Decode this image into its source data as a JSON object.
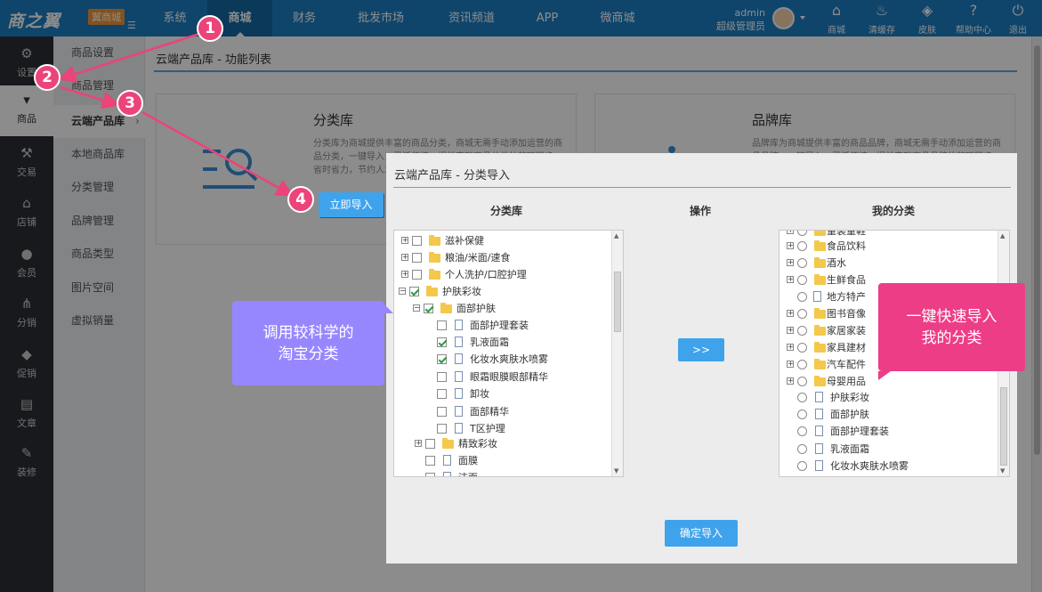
{
  "brand": {
    "logo_text": "商之翼",
    "badge": "翼商城",
    "menu_toggle": "☰"
  },
  "nav": [
    {
      "label": "系统"
    },
    {
      "label": "商城"
    },
    {
      "label": "财务"
    },
    {
      "label": "批发市场"
    },
    {
      "label": "资讯频道"
    },
    {
      "label": "APP"
    },
    {
      "label": "微商城"
    }
  ],
  "user": {
    "name": "admin",
    "role": "超级管理员"
  },
  "top_tools": [
    {
      "label": "商城",
      "icon": "home-icon",
      "glyph": "⌂"
    },
    {
      "label": "清缓存",
      "icon": "broom-icon",
      "glyph": "♨"
    },
    {
      "label": "皮肤",
      "icon": "paint-bucket-icon",
      "glyph": "◈"
    },
    {
      "label": "帮助中心",
      "icon": "help-icon",
      "glyph": "?"
    },
    {
      "label": "退出",
      "icon": "power-icon",
      "glyph": "⏻"
    }
  ],
  "side1": [
    {
      "label": "设置",
      "icon": "gears-icon",
      "glyph": "⚙"
    },
    {
      "label": "商品",
      "icon": "cart-icon",
      "glyph": "▾"
    },
    {
      "label": "交易",
      "icon": "gavel-icon",
      "glyph": "⚒"
    },
    {
      "label": "店铺",
      "icon": "bank-icon",
      "glyph": "⌂"
    },
    {
      "label": "会员",
      "icon": "user-icon",
      "glyph": "●"
    },
    {
      "label": "分销",
      "icon": "share-icon",
      "glyph": "⋔"
    },
    {
      "label": "促销",
      "icon": "tags-icon",
      "glyph": "◆"
    },
    {
      "label": "文章",
      "icon": "document-icon",
      "glyph": "▤"
    },
    {
      "label": "装修",
      "icon": "brush-icon",
      "glyph": "✎"
    }
  ],
  "side2": [
    {
      "label": "商品设置"
    },
    {
      "label": "商品管理"
    },
    {
      "label": "云端产品库"
    },
    {
      "label": "本地商品库"
    },
    {
      "label": "分类管理"
    },
    {
      "label": "品牌管理"
    },
    {
      "label": "商品类型"
    },
    {
      "label": "图片空间"
    },
    {
      "label": "虚拟销量"
    }
  ],
  "side2_arrow": "›",
  "page": {
    "breadcrumb": "云端产品库 - 功能列表"
  },
  "cards": {
    "category": {
      "title": "分类库",
      "desc": "分类库为商城提供丰富的商品分类，商城无需手动添加运营的商品分类，一键导入，灵活便捷，提前实现商品分类的整理同步，省时省力，节约人工成本。",
      "button": "立即导入"
    },
    "brand": {
      "title": "品牌库",
      "desc": "品牌库为商城提供丰富的商品品牌，商城无需手动添加运营的商品品牌，一键导入，灵活便捷，提前实现商品品牌的整理同步。"
    }
  },
  "modal": {
    "title": "云端产品库 - 分类导入",
    "col_left": "分类库",
    "col_mid": "操作",
    "col_right": "我的分类",
    "move_button": ">>",
    "confirm_button": "确定导入",
    "left_tree": [
      "滋补保健",
      "粮油/米面/速食",
      "个人洗护/口腔护理",
      "护肤彩妆",
      "面部护肤",
      "面部护理套装",
      "乳液面霜",
      "化妆水爽肤水喷雾",
      "眼霜眼膜眼部精华",
      "卸妆",
      "面部精华",
      "T区护理",
      "精致彩妆",
      "面膜",
      "洁面"
    ],
    "right_tree": [
      "童装童鞋",
      "食品饮料",
      "酒水",
      "生鲜食品",
      "地方特产",
      "图书音像",
      "家居家装",
      "家具建材",
      "汽车配件",
      "母婴用品",
      "护肤彩妆",
      "面部护肤",
      "面部护理套装",
      "乳液面霜",
      "化妆水爽肤水喷雾"
    ]
  },
  "callouts": {
    "left_line1": "调用较科学的",
    "left_line2": "淘宝分类",
    "right_line1": "一键快速导入",
    "right_line2": "我的分类"
  },
  "steps": [
    "1",
    "2",
    "3",
    "4"
  ],
  "colors": {
    "primary": "#1c7fc4",
    "button": "#3fa3ec",
    "callout_left": "#9787ff",
    "callout_right": "#ed3d86",
    "step_badge": "#ec4379"
  }
}
